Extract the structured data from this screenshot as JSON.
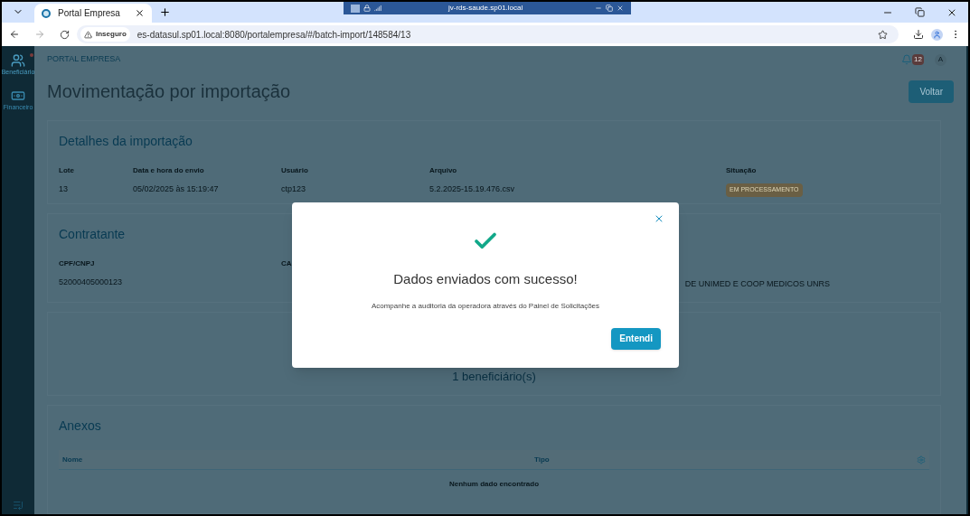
{
  "browser": {
    "tab_title": "Portal Empresa",
    "security_label": "Inseguro",
    "url": "es-datasul.sp01.local:8080/portalempresa/#/batch-import/148584/13"
  },
  "remote_bar": {
    "title": "jv-rds-saude.sp01.local"
  },
  "sidebar": {
    "items": [
      {
        "label": "Beneficiário",
        "kind": "people",
        "selected": true
      },
      {
        "label": "Financeiro",
        "kind": "money",
        "selected": false
      }
    ]
  },
  "header": {
    "brand": "PORTAL EMPRESA",
    "notification_count": "12",
    "avatar": "A"
  },
  "page": {
    "title": "Movimentação por importação",
    "back_button": "Voltar"
  },
  "details": {
    "title": "Detalhes da importação",
    "fields": [
      {
        "label": "Lote",
        "value": "13"
      },
      {
        "label": "Data e hora do envio",
        "value": "05/02/2025 às 15:19:47"
      },
      {
        "label": "Usuário",
        "value": "ctp123"
      },
      {
        "label": "Arquivo",
        "value": "5.2.2025-15.19.476.csv"
      }
    ],
    "status": {
      "label": "Situação",
      "value": "EM PROCESSAMENTO"
    }
  },
  "contractor": {
    "title": "Contratante",
    "fields": [
      {
        "label": "CPF/CNPJ",
        "value": "52000405000123"
      },
      {
        "label": "CA"
      }
    ],
    "name_fragment": "DE UNIMED E COOP MEDICOS UNRS"
  },
  "summary": {
    "count": "1 beneficiário(s)"
  },
  "attachments": {
    "title": "Anexos",
    "columns": [
      "Nome",
      "Tipo"
    ],
    "empty": "Nenhum dado encontrado"
  },
  "dialog": {
    "title": "Dados enviados com sucesso!",
    "message": "Acompanhe a auditoria da operadora através do Painel de Solicitações",
    "button": "Entendi"
  }
}
